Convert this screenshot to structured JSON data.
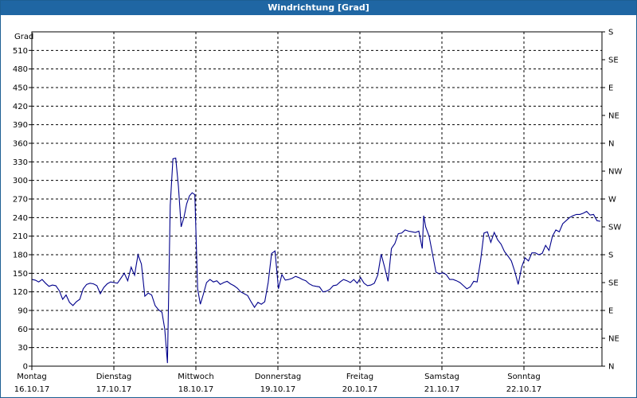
{
  "window": {
    "title": "Windrichtung [Grad]"
  },
  "chart_data": {
    "type": "line",
    "title": "Windrichtung [Grad]",
    "ylabel": "Grad",
    "ylim": [
      0,
      540
    ],
    "xlim": [
      0,
      7
    ],
    "grid": true,
    "y_ticks": [
      0,
      30,
      60,
      90,
      120,
      150,
      180,
      210,
      240,
      270,
      300,
      330,
      360,
      390,
      420,
      450,
      480,
      510
    ],
    "y2_ticks": [
      {
        "value": 0,
        "label": "N"
      },
      {
        "value": 45,
        "label": "NE"
      },
      {
        "value": 90,
        "label": "E"
      },
      {
        "value": 135,
        "label": "SE"
      },
      {
        "value": 180,
        "label": "S"
      },
      {
        "value": 225,
        "label": "SW"
      },
      {
        "value": 270,
        "label": "W"
      },
      {
        "value": 315,
        "label": "NW"
      },
      {
        "value": 360,
        "label": "N"
      },
      {
        "value": 405,
        "label": "NE"
      },
      {
        "value": 450,
        "label": "E"
      },
      {
        "value": 495,
        "label": "SE"
      },
      {
        "value": 540,
        "label": "S"
      }
    ],
    "x_ticks": [
      {
        "pos": 0,
        "day": "Montag",
        "date": "16.10.17"
      },
      {
        "pos": 1,
        "day": "Dienstag",
        "date": "17.10.17"
      },
      {
        "pos": 2,
        "day": "Mittwoch",
        "date": "18.10.17"
      },
      {
        "pos": 3,
        "day": "Donnerstag",
        "date": "19.10.17"
      },
      {
        "pos": 4,
        "day": "Freitag",
        "date": "20.10.17"
      },
      {
        "pos": 5,
        "day": "Samstag",
        "date": "21.10.17"
      },
      {
        "pos": 6,
        "day": "Sonntag",
        "date": "22.10.17"
      }
    ],
    "series": [
      {
        "color": "#00008b",
        "points": [
          [
            0.0,
            140
          ],
          [
            0.05,
            139
          ],
          [
            0.1,
            136
          ],
          [
            0.15,
            140
          ],
          [
            0.2,
            134
          ],
          [
            0.25,
            129
          ],
          [
            0.3,
            131
          ],
          [
            0.35,
            130
          ],
          [
            0.4,
            122
          ],
          [
            0.45,
            108
          ],
          [
            0.5,
            115
          ],
          [
            0.55,
            103
          ],
          [
            0.6,
            98
          ],
          [
            0.65,
            104
          ],
          [
            0.7,
            108
          ],
          [
            0.75,
            125
          ],
          [
            0.8,
            132
          ],
          [
            0.85,
            134
          ],
          [
            0.9,
            133
          ],
          [
            0.95,
            130
          ],
          [
            1.0,
            117
          ],
          [
            1.05,
            127
          ],
          [
            1.1,
            133
          ],
          [
            1.15,
            136
          ],
          [
            1.2,
            135
          ],
          [
            1.25,
            134
          ],
          [
            1.3,
            142
          ],
          [
            1.35,
            150
          ],
          [
            1.4,
            138
          ],
          [
            1.45,
            160
          ],
          [
            1.5,
            147
          ],
          [
            1.55,
            180
          ],
          [
            1.6,
            165
          ],
          [
            1.65,
            113
          ],
          [
            1.7,
            118
          ],
          [
            1.75,
            115
          ],
          [
            1.8,
            98
          ],
          [
            1.85,
            91
          ],
          [
            1.9,
            87
          ],
          [
            1.94,
            60
          ],
          [
            1.98,
            5
          ],
          [
            2.02,
            260
          ],
          [
            2.06,
            335
          ],
          [
            2.1,
            336
          ],
          [
            2.14,
            290
          ],
          [
            2.18,
            225
          ],
          [
            2.22,
            240
          ],
          [
            2.26,
            262
          ],
          [
            2.3,
            275
          ],
          [
            2.34,
            280
          ],
          [
            2.38,
            277
          ],
          [
            2.42,
            125
          ],
          [
            2.46,
            100
          ],
          [
            2.5,
            115
          ],
          [
            2.55,
            135
          ],
          [
            2.6,
            140
          ],
          [
            2.65,
            136
          ],
          [
            2.7,
            138
          ],
          [
            2.75,
            132
          ],
          [
            2.8,
            135
          ],
          [
            2.85,
            137
          ],
          [
            2.9,
            133
          ],
          [
            2.95,
            130
          ],
          [
            3.0,
            126
          ],
          [
            3.05,
            120
          ],
          [
            3.1,
            117
          ],
          [
            3.15,
            114
          ],
          [
            3.2,
            104
          ],
          [
            3.25,
            95
          ],
          [
            3.3,
            103
          ],
          [
            3.35,
            100
          ],
          [
            3.4,
            104
          ],
          [
            3.45,
            135
          ],
          [
            3.5,
            182
          ],
          [
            3.55,
            186
          ],
          [
            3.6,
            125
          ],
          [
            3.65,
            148
          ],
          [
            3.7,
            139
          ],
          [
            3.75,
            140
          ],
          [
            3.8,
            142
          ],
          [
            3.85,
            145
          ],
          [
            3.9,
            143
          ],
          [
            3.95,
            140
          ],
          [
            4.0,
            138
          ],
          [
            4.05,
            133
          ],
          [
            4.1,
            130
          ],
          [
            4.15,
            129
          ],
          [
            4.2,
            128
          ],
          [
            4.25,
            120
          ],
          [
            4.3,
            121
          ],
          [
            4.35,
            124
          ],
          [
            4.4,
            130
          ],
          [
            4.45,
            131
          ],
          [
            4.5,
            136
          ],
          [
            4.55,
            140
          ],
          [
            4.6,
            138
          ],
          [
            4.65,
            135
          ],
          [
            4.7,
            140
          ],
          [
            4.75,
            134
          ],
          [
            4.8,
            143
          ],
          [
            4.85,
            134
          ],
          [
            4.9,
            130
          ],
          [
            4.95,
            131
          ],
          [
            5.0,
            134
          ],
          [
            5.05,
            147
          ],
          [
            5.1,
            181
          ],
          [
            5.15,
            160
          ],
          [
            5.2,
            137
          ],
          [
            5.25,
            190
          ],
          [
            5.3,
            198
          ],
          [
            5.35,
            214
          ],
          [
            5.4,
            215
          ],
          [
            5.45,
            220
          ],
          [
            5.5,
            218
          ],
          [
            5.55,
            217
          ],
          [
            5.6,
            216
          ],
          [
            5.65,
            218
          ],
          [
            5.7,
            190
          ],
          [
            5.72,
            243
          ],
          [
            5.75,
            225
          ],
          [
            5.8,
            210
          ],
          [
            5.85,
            181
          ],
          [
            5.9,
            152
          ],
          [
            5.95,
            149
          ],
          [
            6.0,
            151
          ],
          [
            6.05,
            148
          ],
          [
            6.1,
            140
          ],
          [
            6.15,
            140
          ],
          [
            6.2,
            138
          ],
          [
            6.25,
            135
          ],
          [
            6.3,
            130
          ],
          [
            6.35,
            125
          ],
          [
            6.4,
            128
          ],
          [
            6.45,
            137
          ],
          [
            6.5,
            136
          ],
          [
            6.55,
            170
          ],
          [
            6.6,
            215
          ],
          [
            6.65,
            217
          ],
          [
            6.7,
            200
          ],
          [
            6.75,
            216
          ],
          [
            6.8,
            204
          ],
          [
            6.85,
            197
          ],
          [
            6.9,
            185
          ],
          [
            6.95,
            178
          ],
          [
            7.0,
            170
          ],
          [
            7.05,
            153
          ],
          [
            7.1,
            132
          ],
          [
            7.15,
            160
          ],
          [
            7.2,
            175
          ],
          [
            7.25,
            170
          ],
          [
            7.3,
            183
          ],
          [
            7.35,
            183
          ],
          [
            7.4,
            180
          ],
          [
            7.45,
            182
          ],
          [
            7.5,
            195
          ],
          [
            7.55,
            187
          ],
          [
            7.6,
            210
          ],
          [
            7.65,
            220
          ],
          [
            7.7,
            217
          ],
          [
            7.75,
            230
          ],
          [
            7.8,
            235
          ],
          [
            7.85,
            240
          ],
          [
            7.9,
            243
          ],
          [
            7.95,
            245
          ],
          [
            8.0,
            245
          ],
          [
            8.05,
            247
          ],
          [
            8.1,
            250
          ],
          [
            8.15,
            244
          ],
          [
            8.2,
            245
          ],
          [
            8.25,
            235
          ],
          [
            8.3,
            234
          ]
        ]
      }
    ]
  }
}
